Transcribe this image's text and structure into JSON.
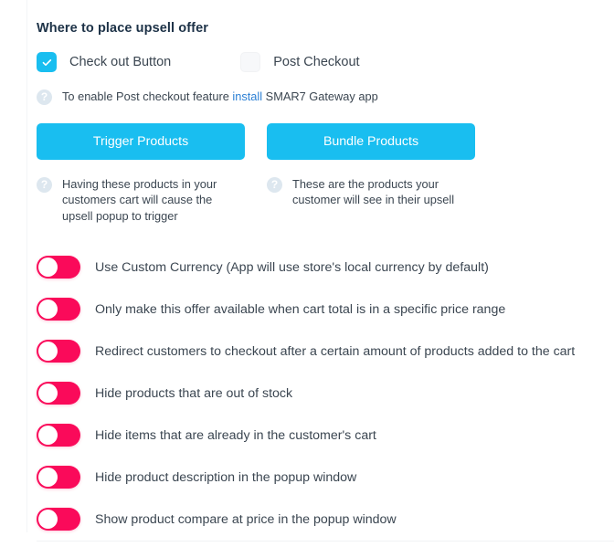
{
  "section": {
    "title": "Where to place upsell offer"
  },
  "colors": {
    "accent_cyan": "#19bef0",
    "toggle_pink": "#fa0a5a",
    "link_blue": "#2b7fd4",
    "title_navy": "#1d3247",
    "body_gray": "#3b4651",
    "help_icon_gray": "#dde7ef"
  },
  "placement_options": [
    {
      "label": "Check out Button",
      "checked": true,
      "icon": "check-icon"
    },
    {
      "label": "Post Checkout",
      "checked": false,
      "icon": ""
    }
  ],
  "install_note": {
    "icon": "help-circle-icon",
    "prefix": "To enable Post checkout feature ",
    "link_text": "install",
    "suffix": " SMAR7 Gateway app"
  },
  "product_buttons": [
    {
      "label": "Trigger Products",
      "description": "Having these products in your customers cart will cause the upsell popup to trigger",
      "icon": "help-circle-icon"
    },
    {
      "label": "Bundle Products",
      "description": "These are the products your customer will see in their upsell",
      "icon": "help-circle-icon"
    }
  ],
  "toggles": [
    {
      "label": "Use Custom Currency (App will use store's local currency by default)",
      "on": false
    },
    {
      "label": "Only make this offer available when cart total is in a specific price range",
      "on": false
    },
    {
      "label": "Redirect customers to checkout after a certain amount of products added to the cart",
      "on": false
    },
    {
      "label": "Hide products that are out of stock",
      "on": false
    },
    {
      "label": "Hide items that are already in the customer's cart",
      "on": false
    },
    {
      "label": "Hide product description in the popup window",
      "on": false
    },
    {
      "label": "Show product compare at price in the popup window",
      "on": false
    }
  ]
}
